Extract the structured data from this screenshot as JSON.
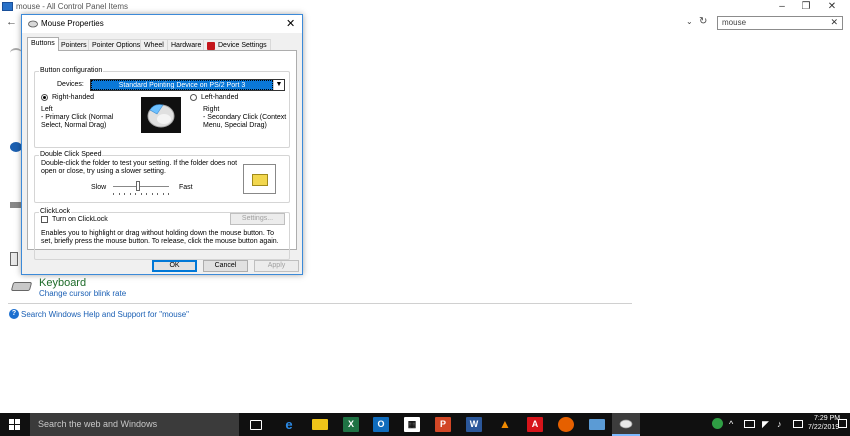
{
  "control_panel": {
    "window_title": "mouse - All Control Panel Items",
    "search_value": "mouse",
    "keyboard_title": "Keyboard",
    "keyboard_link": "Change cursor blink rate",
    "help_link": "Search Windows Help and Support for \"mouse\""
  },
  "dialog": {
    "title": "Mouse Properties",
    "tabs": [
      "Buttons",
      "Pointers",
      "Pointer Options",
      "Wheel",
      "Hardware",
      "Device Settings"
    ],
    "active_tab": "Buttons",
    "button_config": {
      "group_title": "Button configuration",
      "devices_label": "Devices:",
      "devices_value": "Standard Pointing Device on PS/2 Port 3",
      "right_handed_label": "Right-handed",
      "left_handed_label": "Left-handed",
      "right_handed_selected": true,
      "left_heading": "Left",
      "left_desc": "- Primary Click (Normal Select, Normal Drag)",
      "right_heading": "Right",
      "right_desc": "- Secondary Click (Context Menu, Special Drag)"
    },
    "double_click": {
      "group_title": "Double Click Speed",
      "description": "Double-click the folder to test your setting.  If the folder does not open or close, try using a slower setting.",
      "slow_label": "Slow",
      "fast_label": "Fast",
      "speed_fraction": 0.45
    },
    "clicklock": {
      "group_title": "ClickLock",
      "checkbox_label": "Turn on ClickLock",
      "checked": false,
      "settings_button": "Settings...",
      "description": "Enables you to highlight or drag without holding down the mouse button.  To set, briefly press the mouse button.  To release, click the mouse button again."
    },
    "buttons": {
      "ok": "OK",
      "cancel": "Cancel",
      "apply": "Apply"
    }
  },
  "taskbar": {
    "search_placeholder": "Search the web and Windows",
    "clock_time": "7:29 PM",
    "clock_date": "7/22/2019",
    "apps": [
      "task-view",
      "edge",
      "explorer",
      "excel",
      "outlook",
      "store",
      "powerpoint",
      "word",
      "vlc",
      "acrobat",
      "firefox",
      "remote-desktop",
      "mouse-properties"
    ]
  },
  "colors": {
    "accent": "#0078d7",
    "selection": "#0a78d7",
    "link": "#1a5fb4",
    "taskbar": "#101010"
  }
}
